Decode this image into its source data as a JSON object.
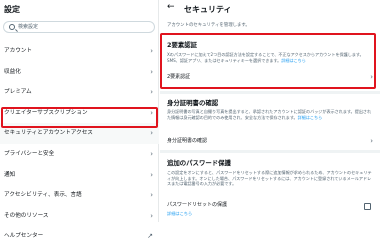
{
  "left": {
    "title": "設定",
    "search_placeholder": "検索設定",
    "items": [
      {
        "label": "アカウント"
      },
      {
        "label": "収益化"
      },
      {
        "label": "プレミアム"
      },
      {
        "label": "クリエイターサブスクリプション"
      },
      {
        "label": "セキュリティとアカウントアクセス"
      },
      {
        "label": "プライバシーと安全"
      },
      {
        "label": "通知"
      },
      {
        "label": "アクセシビリティ、表示、言語"
      },
      {
        "label": "その他のリソース"
      },
      {
        "label": "ヘルプセンター"
      }
    ]
  },
  "right": {
    "title": "セキュリティ",
    "subtitle": "アカウントのセキュリティを管理します。",
    "two_factor": {
      "title": "2要素認証",
      "description": "Xのパスワードに加えて2つ目の認証方法を設定することで、不正なアクセスからアカウントを保護します。SMS、認証アプリ、またはセキュリティキーを選択できます。",
      "link": "詳細はこちら",
      "row_label": "2要素認証"
    },
    "id_verification": {
      "title": "身分証明書の確認",
      "description": "身分証明書の写真と自撮り写真を提出すると、承認されたアカウントに認証のバッジが表示されます。提出された情報は身元確認の目的でのみ使用され、安全な方法で保存されます。",
      "link": "詳細はこちら",
      "row_label": "身分証明書の確認"
    },
    "password_protection": {
      "title": "追加のパスワード保護",
      "description": "この設定をオンにすると、パスワードをリセットする際に追加情報が求められるため、アカウントのセキュリティが向上します。オンにした場合、パスワードをリセットするには、アカウントに登録されているメールアドレスまたは電話番号の入力が必要です。",
      "row_label": "パスワードリセットの保護",
      "link": "詳細はこちら",
      "checked": false
    }
  },
  "colors": {
    "highlight": "#e0141e",
    "accent": "#1d9bf0",
    "muted": "#536471"
  }
}
